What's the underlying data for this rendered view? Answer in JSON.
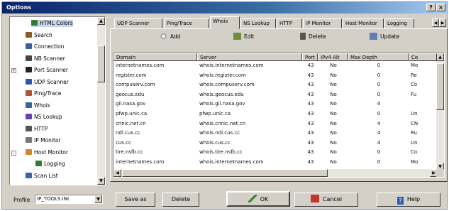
{
  "window": {
    "title": "Options"
  },
  "tree": {
    "items": [
      {
        "label": "HTML Colors",
        "icon": "html-colors-icon",
        "color": "#2e7d32",
        "expander": ""
      },
      {
        "label": "Search",
        "icon": "search-icon",
        "color": "#8a5a2b",
        "expander": ""
      },
      {
        "label": "Connection",
        "icon": "connection-icon",
        "color": "#3a5fa0",
        "expander": ""
      },
      {
        "label": "NB Scanner",
        "icon": "scanner-icon",
        "color": "#444444",
        "expander": ""
      },
      {
        "label": "Port Scanner",
        "icon": "binoculars-icon",
        "color": "#222222",
        "expander": "+"
      },
      {
        "label": "UDP Scanner",
        "icon": "udp-scanner-icon",
        "color": "#3355aa",
        "expander": ""
      },
      {
        "label": "Ping/Trace",
        "icon": "ping-trace-icon",
        "color": "#aa5533",
        "expander": ""
      },
      {
        "label": "Whois",
        "icon": "whois-icon",
        "color": "#336699",
        "expander": ""
      },
      {
        "label": "NS Lookup",
        "icon": "ns-lookup-icon",
        "color": "#6644aa",
        "expander": ""
      },
      {
        "label": "HTTP",
        "icon": "http-icon",
        "color": "#555555",
        "expander": ""
      },
      {
        "label": "IP Monitor",
        "icon": "ip-monitor-icon",
        "color": "#777777",
        "expander": ""
      },
      {
        "label": "Host Monitor",
        "icon": "host-monitor-icon",
        "color": "#cc8833",
        "expander": "-"
      },
      {
        "label": "Logging",
        "icon": "logging-icon",
        "color": "#2e7d32",
        "expander": ""
      },
      {
        "label": "Scan List",
        "icon": "scan-list-icon",
        "color": "#3366aa",
        "expander": ""
      }
    ]
  },
  "tabs": [
    {
      "label": "UDP Scanner"
    },
    {
      "label": "Ping/Trace"
    },
    {
      "label": "Whois"
    },
    {
      "label": "NS Lookup"
    },
    {
      "label": "HTTP"
    },
    {
      "label": "IP Monitor"
    },
    {
      "label": "Host Monitor"
    },
    {
      "label": "Logging"
    }
  ],
  "toolbar": {
    "add": "Add",
    "edit": "Edit",
    "delete": "Delete",
    "update": "Update"
  },
  "grid": {
    "columns": [
      "Domain",
      "Server",
      "Port",
      "IPv4 Alt",
      "Max Depth",
      "Co"
    ],
    "rows": [
      [
        "internetnames.com",
        "whois.internetnames.com",
        "43",
        "No",
        "0",
        "Mo"
      ],
      [
        "register.com",
        "whois.register.com",
        "43",
        "No",
        "0",
        "Re"
      ],
      [
        "compuserv.com",
        "whois.compuserv.com",
        "43",
        "No",
        "0",
        "Co"
      ],
      [
        "geocus.edu",
        "whois.geocus.edu",
        "43",
        "No",
        "0",
        "Fu"
      ],
      [
        "gil.nasa.gov",
        "whois.gil.nasa.gov",
        "43",
        "No",
        "4",
        ""
      ],
      [
        "pfwp.unic.ca",
        "pfwp.unic.ca",
        "43",
        "No",
        "0",
        "Un"
      ],
      [
        "cnnic.net.cn",
        "whois.cnnic.net.cn",
        "43",
        "No",
        "4",
        "CN"
      ],
      [
        "ndl.cus.cc",
        "whois.ndl.cus.cc",
        "43",
        "No",
        "4",
        "Ru"
      ],
      [
        "cus.cc",
        "whois.cus.cc",
        "43",
        "No",
        "4",
        "Un"
      ],
      [
        "tire.nsfb.cc",
        "whois.tire.nsfb.cc",
        "43",
        "No",
        "0",
        "Co"
      ],
      [
        "internetnames.com",
        "whois.internetnames.com",
        "43",
        "No",
        "0",
        "Mo"
      ]
    ]
  },
  "bottom": {
    "profile_label": "Profile",
    "profile_value": "IP_TOOLS.INI",
    "save_as": "Save as",
    "delete": "Delete",
    "ok": "OK",
    "cancel": "Cancel",
    "help": "Help"
  }
}
